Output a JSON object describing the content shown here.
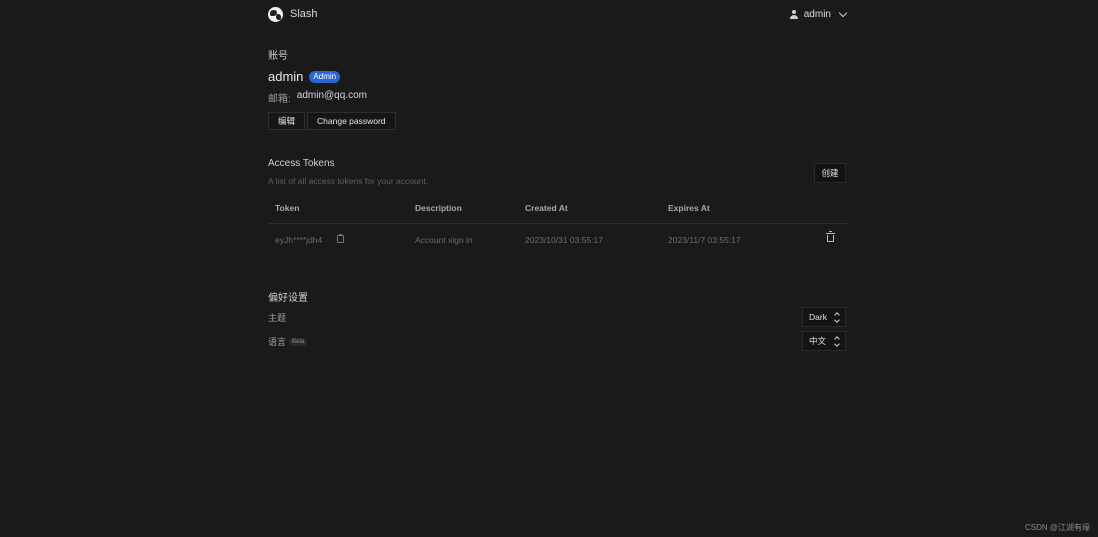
{
  "header": {
    "brand_name": "Slash",
    "user_name": "admin"
  },
  "account": {
    "section_title": "账号",
    "username": "admin",
    "role_badge": "Admin",
    "email_label": "邮箱:",
    "email_value": "admin@qq.com",
    "edit_button": "编辑",
    "change_password_button": "Change password"
  },
  "tokens": {
    "title": "Access Tokens",
    "description": "A list of all access tokens for your account.",
    "create_button": "创建",
    "columns": {
      "token": "Token",
      "description": "Description",
      "created_at": "Created At",
      "expires_at": "Expires At"
    },
    "rows": [
      {
        "token": "eyJh****jdh4",
        "description": "Account sign in",
        "created_at": "2023/10/31 03:55:17",
        "expires_at": "2023/11/7 03:55:17"
      }
    ]
  },
  "preferences": {
    "title": "偏好设置",
    "theme_label": "主题",
    "theme_value": "Dark",
    "language_label": "语言",
    "language_badge": "Beta",
    "language_value": "中文"
  },
  "watermark": "CSDN @江湖有缘",
  "colors": {
    "background": "#1a1a1a",
    "badge_blue": "#2b66d6"
  },
  "icons": [
    "slash-logo-icon",
    "user-icon",
    "chevron-down-icon",
    "copy-icon",
    "trash-icon",
    "select-arrows-icon"
  ]
}
